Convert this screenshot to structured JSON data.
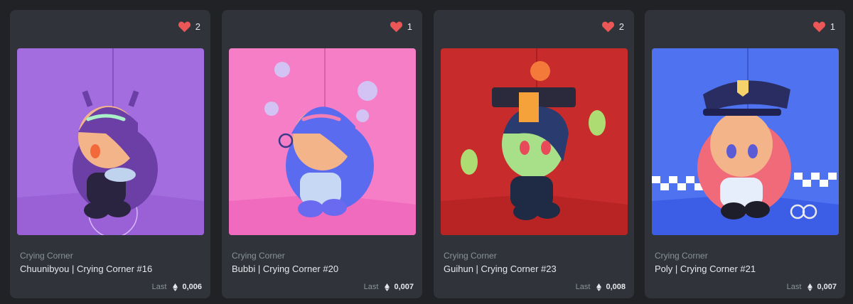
{
  "cards": [
    {
      "likes": "2",
      "collection": "Crying Corner",
      "title": "Chuunibyou | Crying Corner #16",
      "price_label": "Last",
      "price": "0,006",
      "bg": "#a36de0",
      "floor": "#9a60d6",
      "hair": "#6b3fa6",
      "accent": "#a9f0c8"
    },
    {
      "likes": "1",
      "collection": "Crying Corner",
      "title": "Bubbi | Crying Corner #20",
      "price_label": "Last",
      "price": "0,007",
      "bg": "#f67ec7",
      "floor": "#f06bbd",
      "hair": "#5a6bf0",
      "accent": "#b3d7ff"
    },
    {
      "likes": "2",
      "collection": "Crying Corner",
      "title": "Guihun | Crying Corner #23",
      "price_label": "Last",
      "price": "0,008",
      "bg": "#c72b2b",
      "floor": "#b82424",
      "hair": "#2a3b6f",
      "accent": "#a8f07a"
    },
    {
      "likes": "1",
      "collection": "Crying Corner",
      "title": "Poly | Crying Corner #21",
      "price_label": "Last",
      "price": "0,007",
      "bg": "#4e72f0",
      "floor": "#3c5ee6",
      "hair": "#f06a7a",
      "accent": "#ffffff"
    }
  ],
  "colors": {
    "heart": "#eb5757",
    "card_bg": "#303339",
    "page_bg": "#202225"
  },
  "icons": {
    "like": "heart-icon",
    "currency": "ethereum-icon"
  }
}
